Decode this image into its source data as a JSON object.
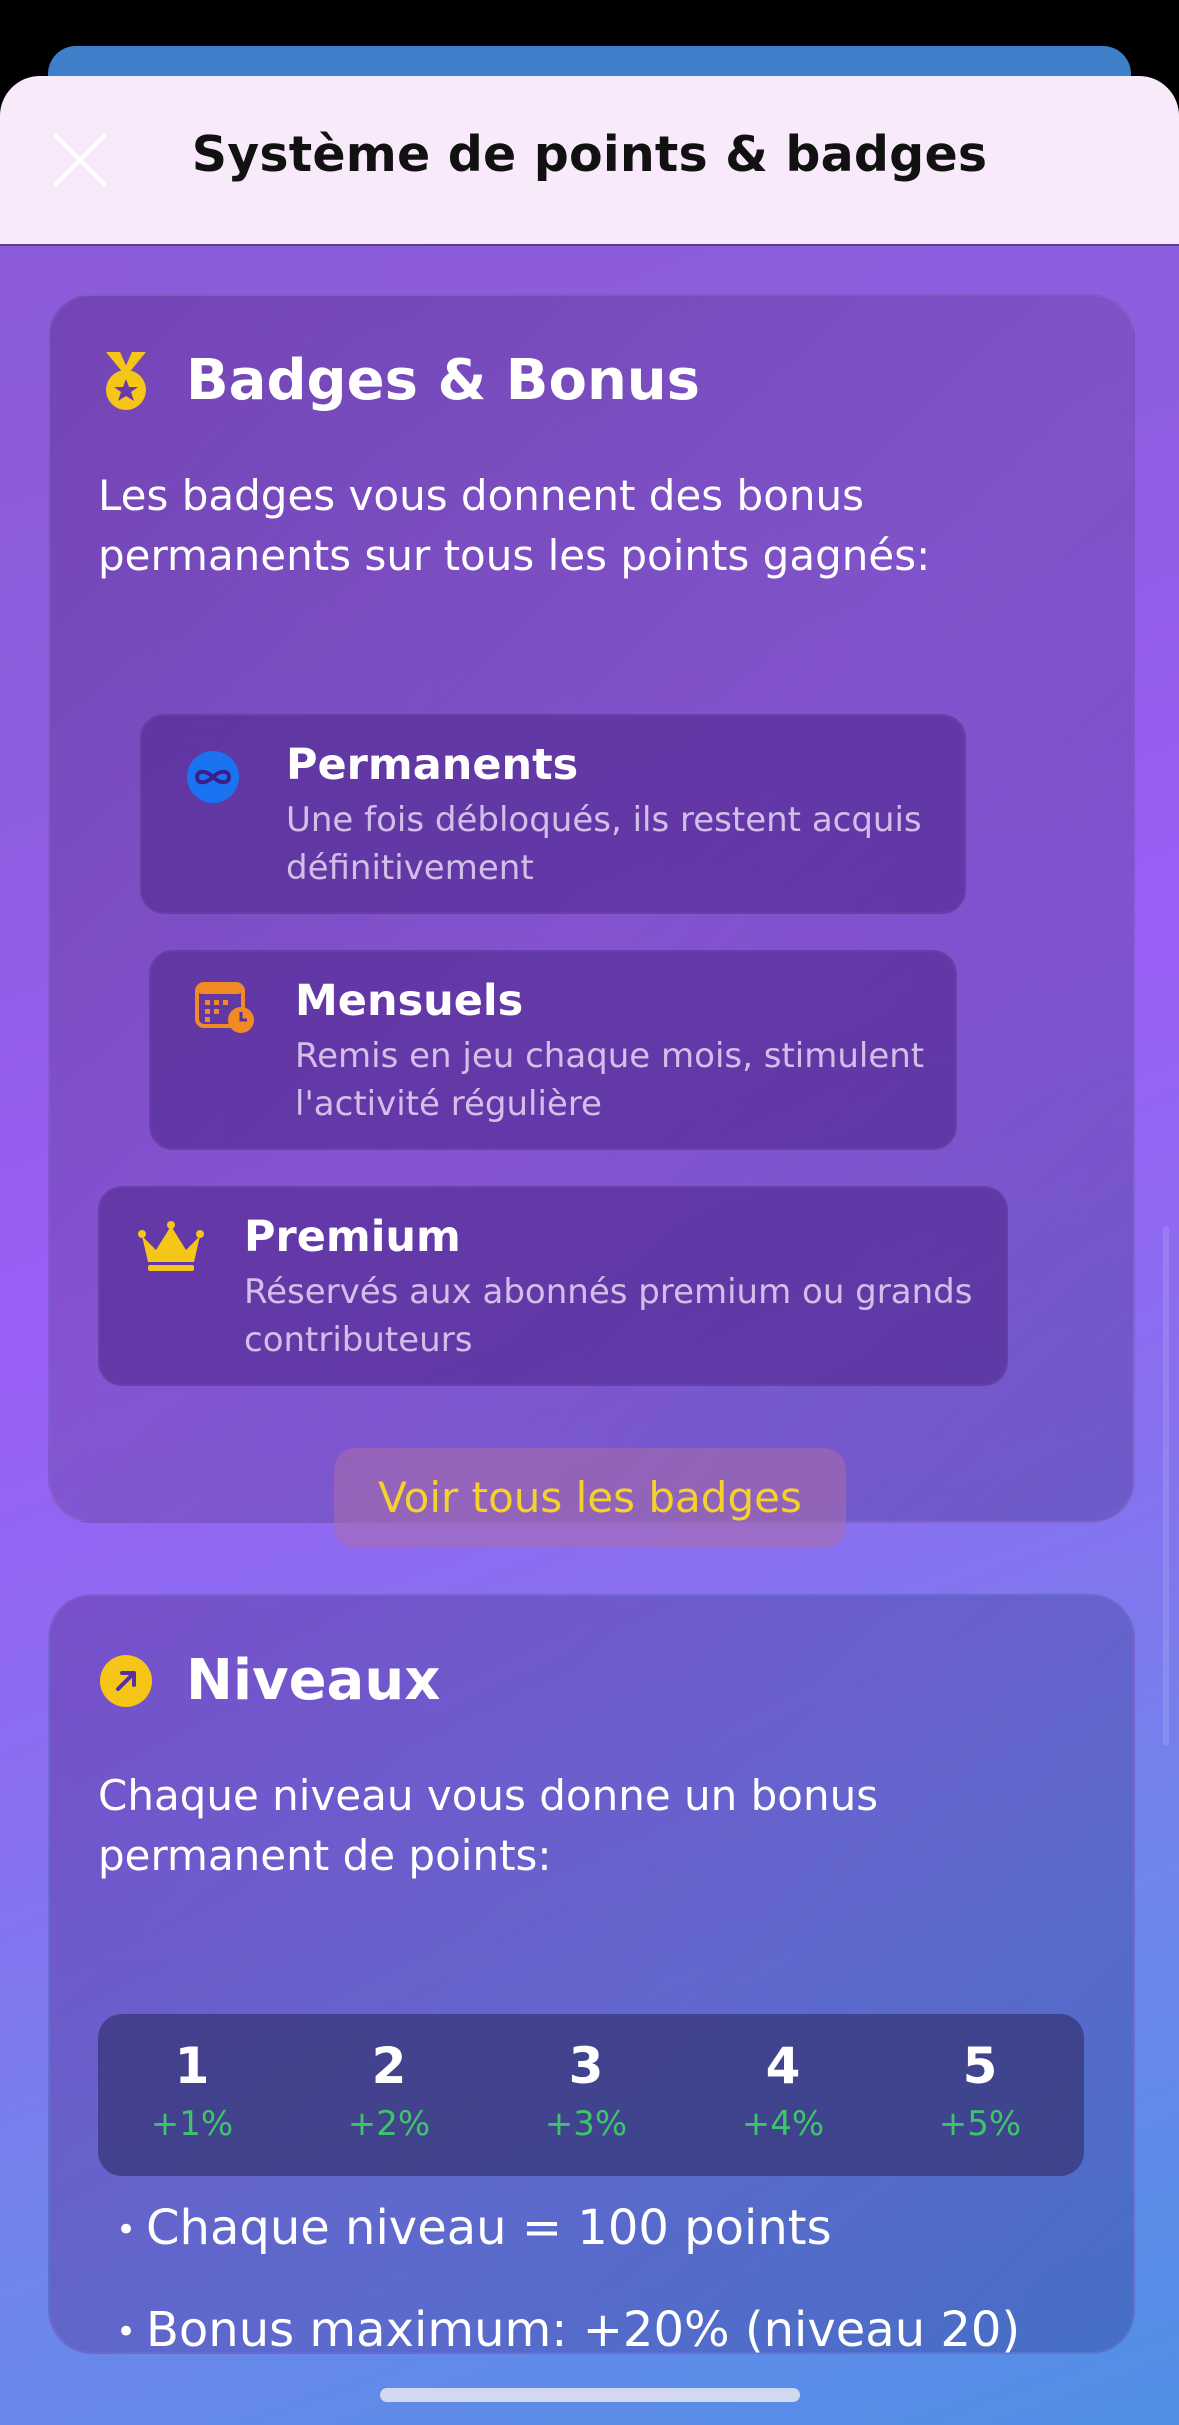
{
  "header": {
    "title": "Système de points & badges"
  },
  "badges_card": {
    "heading": "Badges & Bonus",
    "intro": "Les badges vous donnent des bonus permanents sur tous les points gagnés:",
    "items": [
      {
        "icon": "infinity-icon",
        "title": "Permanents",
        "description": "Une fois débloqués, ils restent acquis définitivement"
      },
      {
        "icon": "calendar-clock-icon",
        "title": "Mensuels",
        "description": "Remis en jeu chaque mois, stimulent l'activité régulière"
      },
      {
        "icon": "crown-icon",
        "title": "Premium",
        "description": "Réservés aux abonnés premium ou grands contributeurs"
      }
    ],
    "button_label": "Voir tous les badges"
  },
  "levels_card": {
    "heading": "Niveaux",
    "intro": "Chaque niveau vous donne un bonus permanent de points:",
    "levels": [
      {
        "number": "1",
        "bonus": "+1%"
      },
      {
        "number": "2",
        "bonus": "+2%"
      },
      {
        "number": "3",
        "bonus": "+3%"
      },
      {
        "number": "4",
        "bonus": "+4%"
      },
      {
        "number": "5",
        "bonus": "+5%"
      }
    ],
    "bullets": [
      "Chaque niveau = 100 points",
      "Bonus maximum: +20% (niveau 20)"
    ]
  },
  "colors": {
    "accent_yellow": "#f5d22a",
    "bonus_green": "#3ec46b",
    "infinity_blue": "#1a73f0",
    "calendar_orange": "#f08a24"
  }
}
